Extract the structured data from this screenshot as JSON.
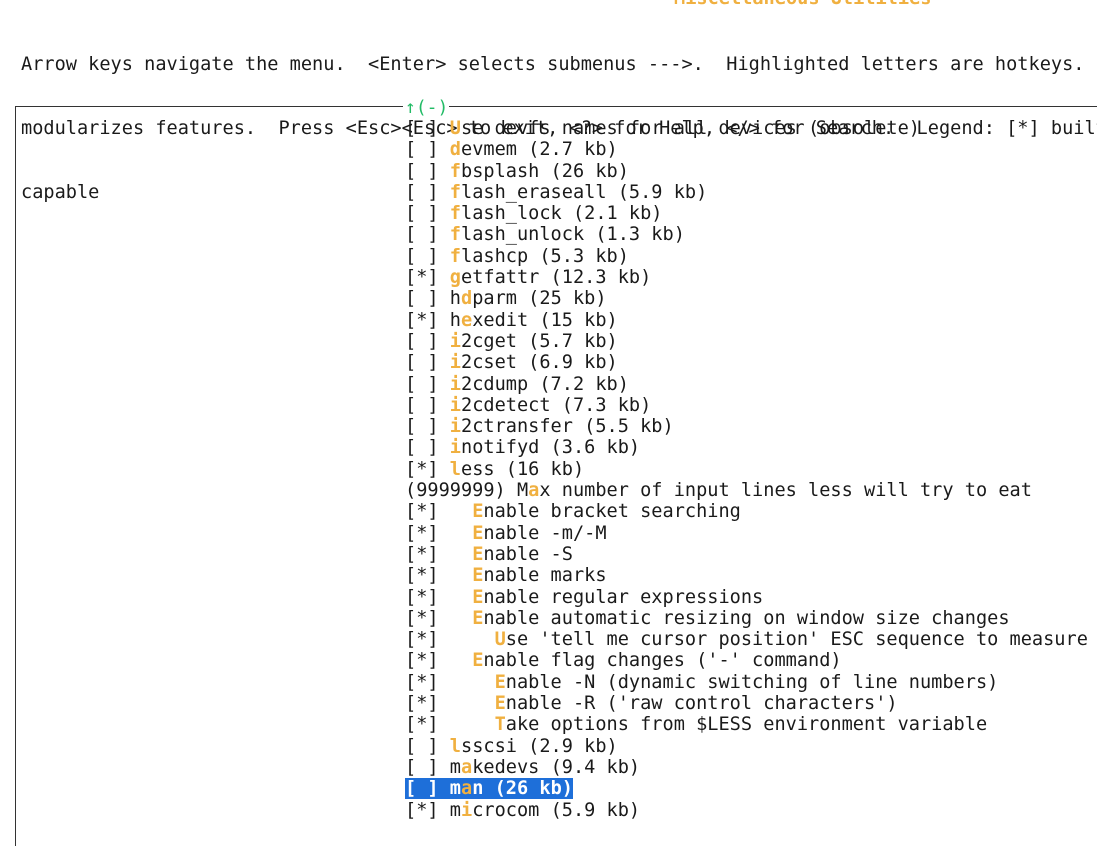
{
  "help_lines": [
    "Arrow keys navigate the menu.  <Enter> selects submenus --->.  Highlighted letters are hotkeys.  Pr",
    "modularizes features.  Press <Esc><Esc> to exit, <?> for Help, </> for Search.  Legend: [*] built-",
    "capable"
  ],
  "menu_title": "Miscellaneous Utilities",
  "scroll_indicator": "↑(-)",
  "items": [
    {
      "check": "[ ]",
      "indent": " ",
      "hot": "U",
      "rest": "se devfs names for all devices (obsolete)",
      "pre": ""
    },
    {
      "check": "[ ]",
      "indent": " ",
      "hot": "d",
      "rest": "evmem (2.7 kb)",
      "pre": ""
    },
    {
      "check": "[ ]",
      "indent": " ",
      "hot": "f",
      "rest": "bsplash (26 kb)",
      "pre": ""
    },
    {
      "check": "[ ]",
      "indent": " ",
      "hot": "f",
      "rest": "lash_eraseall (5.9 kb)",
      "pre": ""
    },
    {
      "check": "[ ]",
      "indent": " ",
      "hot": "f",
      "rest": "lash_lock (2.1 kb)",
      "pre": ""
    },
    {
      "check": "[ ]",
      "indent": " ",
      "hot": "f",
      "rest": "lash_unlock (1.3 kb)",
      "pre": ""
    },
    {
      "check": "[ ]",
      "indent": " ",
      "hot": "f",
      "rest": "lashcp (5.3 kb)",
      "pre": ""
    },
    {
      "check": "[*]",
      "indent": " ",
      "hot": "g",
      "rest": "etfattr (12.3 kb)",
      "pre": ""
    },
    {
      "check": "[ ]",
      "indent": " ",
      "hot": "d",
      "rest": "parm (25 kb)",
      "pre": "h"
    },
    {
      "check": "[*]",
      "indent": " ",
      "hot": "e",
      "rest": "xedit (15 kb)",
      "pre": "h"
    },
    {
      "check": "[ ]",
      "indent": " ",
      "hot": "i",
      "rest": "2cget (5.7 kb)",
      "pre": ""
    },
    {
      "check": "[ ]",
      "indent": " ",
      "hot": "i",
      "rest": "2cset (6.9 kb)",
      "pre": ""
    },
    {
      "check": "[ ]",
      "indent": " ",
      "hot": "i",
      "rest": "2cdump (7.2 kb)",
      "pre": ""
    },
    {
      "check": "[ ]",
      "indent": " ",
      "hot": "i",
      "rest": "2cdetect (7.3 kb)",
      "pre": ""
    },
    {
      "check": "[ ]",
      "indent": " ",
      "hot": "i",
      "rest": "2ctransfer (5.5 kb)",
      "pre": ""
    },
    {
      "check": "[ ]",
      "indent": " ",
      "hot": "i",
      "rest": "notifyd (3.6 kb)",
      "pre": ""
    },
    {
      "check": "[*]",
      "indent": " ",
      "hot": "l",
      "rest": "ess (16 kb)",
      "pre": ""
    },
    {
      "check": "(9999999)",
      "indent": " ",
      "hot": "a",
      "rest": "x number of input lines less will try to eat",
      "pre": "M"
    },
    {
      "check": "[*]",
      "indent": "   ",
      "hot": "E",
      "rest": "nable bracket searching",
      "pre": ""
    },
    {
      "check": "[*]",
      "indent": "   ",
      "hot": "E",
      "rest": "nable -m/-M",
      "pre": ""
    },
    {
      "check": "[*]",
      "indent": "   ",
      "hot": "E",
      "rest": "nable -S",
      "pre": ""
    },
    {
      "check": "[*]",
      "indent": "   ",
      "hot": "E",
      "rest": "nable marks",
      "pre": ""
    },
    {
      "check": "[*]",
      "indent": "   ",
      "hot": "E",
      "rest": "nable regular expressions",
      "pre": ""
    },
    {
      "check": "[*]",
      "indent": "   ",
      "hot": "E",
      "rest": "nable automatic resizing on window size changes",
      "pre": ""
    },
    {
      "check": "[*]",
      "indent": "     ",
      "hot": "U",
      "rest": "se 'tell me cursor position' ESC sequence to measure",
      "pre": ""
    },
    {
      "check": "[*]",
      "indent": "   ",
      "hot": "E",
      "rest": "nable flag changes ('-' command)",
      "pre": ""
    },
    {
      "check": "[*]",
      "indent": "     ",
      "hot": "E",
      "rest": "nable -N (dynamic switching of line numbers)",
      "pre": ""
    },
    {
      "check": "[*]",
      "indent": "     ",
      "hot": "E",
      "rest": "nable -R ('raw control characters')",
      "pre": ""
    },
    {
      "check": "[*]",
      "indent": "     ",
      "hot": "T",
      "rest": "ake options from $LESS environment variable",
      "pre": ""
    },
    {
      "check": "[ ]",
      "indent": " ",
      "hot": "l",
      "rest": "sscsi (2.9 kb)",
      "pre": ""
    },
    {
      "check": "[ ]",
      "indent": " ",
      "hot": "a",
      "rest": "kedevs (9.4 kb)",
      "pre": "m"
    },
    {
      "check": "[ ]",
      "indent": " ",
      "hot": "a",
      "rest": "n (26 kb)",
      "pre": "m",
      "selected": true
    },
    {
      "check": "[*]",
      "indent": " ",
      "hot": "i",
      "rest": "crocom (5.9 kb)",
      "pre": "m"
    }
  ],
  "colors": {
    "hotkey": "#f0b040",
    "selection": "#1e6fd9",
    "scroll_indicator": "#22bb66"
  }
}
